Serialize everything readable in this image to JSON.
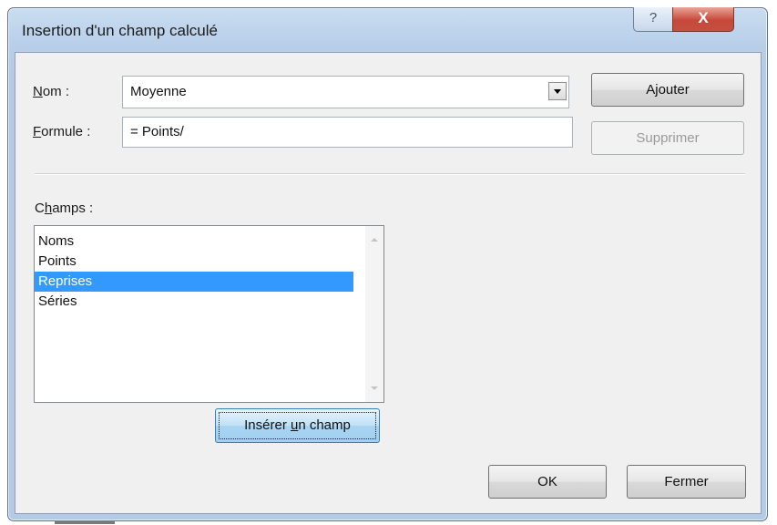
{
  "window": {
    "title": "Insertion d'un champ calculé",
    "help_glyph": "?",
    "close_glyph": "X"
  },
  "nom": {
    "label_initial": "N",
    "label_rest": "om :",
    "value": "Moyenne"
  },
  "formule": {
    "label_initial": "F",
    "label_rest": "ormule :",
    "value": "= Points/"
  },
  "buttons": {
    "ajouter_pre": "A",
    "ajouter_u": "j",
    "ajouter_post": "outer",
    "supprimer": "Supprimer",
    "inserer_pre": "Insérer ",
    "inserer_u": "u",
    "inserer_post": "n champ",
    "ok": "OK",
    "fermer": "Fermer"
  },
  "champs": {
    "label_pre": "C",
    "label_u": "h",
    "label_post": "amps :",
    "items": [
      "Noms",
      "Points",
      "Reprises",
      "Séries"
    ],
    "selected": "Reprises"
  },
  "colors": {
    "selection": "#3399ff",
    "close_button": "#c7483a"
  }
}
